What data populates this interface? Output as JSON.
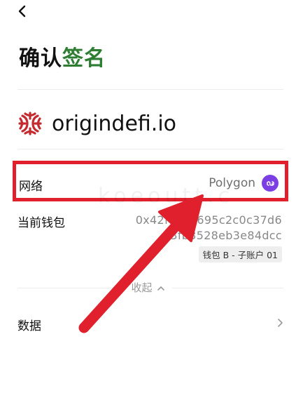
{
  "header": {
    "title_part1": "确认",
    "title_part2": "签名",
    "back_icon": "chevron-left-icon"
  },
  "site": {
    "domain": "origindefi.io",
    "logo_color": "#c42a2f"
  },
  "network": {
    "label": "网络",
    "value": "Polygon",
    "icon": "polygon-icon",
    "icon_color": "#7b3fe4"
  },
  "wallet": {
    "label": "当前钱包",
    "address_line1": "0x42fd0c7695c2c0c37d6",
    "address_line2": "c3fb3528eb3e84dcc",
    "account_name": "钱包 B - 子账户 01"
  },
  "collapse": {
    "label": "收起"
  },
  "data_row": {
    "label": "数据"
  },
  "watermark": "koeoutt.c",
  "colors": {
    "accent_green": "#2e7d32",
    "highlight_red": "#e1202d"
  }
}
